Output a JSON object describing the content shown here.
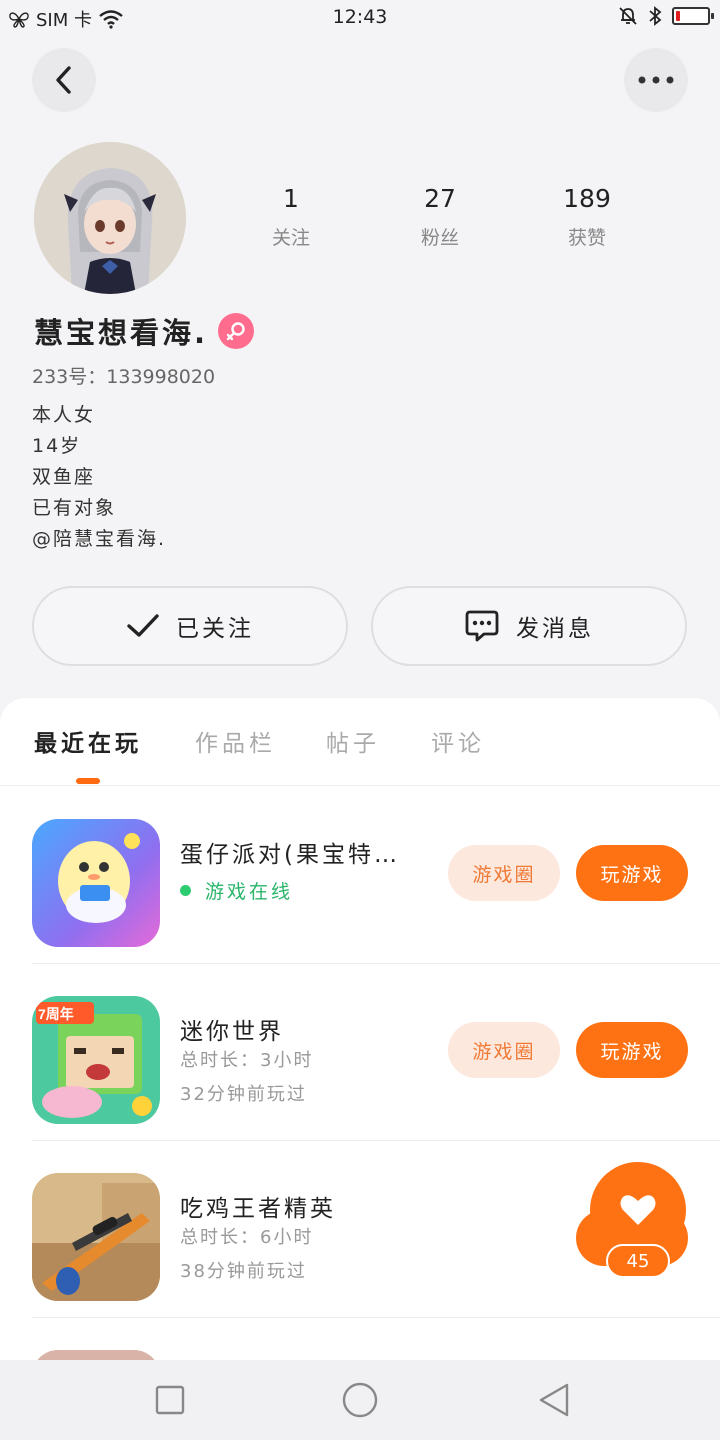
{
  "status_bar": {
    "carrier": "SIM 卡",
    "time": "12:43",
    "battery_level": 0.12
  },
  "nav": {
    "back_icon": "chevron-left-icon",
    "more_icon": "more-dots-icon"
  },
  "profile": {
    "nickname": "慧宝想看海.",
    "gender": "female",
    "uid": "233号：133998020",
    "bio": [
      "本人女",
      "14岁",
      "双鱼座",
      "已有对象",
      "@陪慧宝看海."
    ],
    "stats": [
      {
        "value": "1",
        "label": "关注"
      },
      {
        "value": "27",
        "label": "粉丝"
      },
      {
        "value": "189",
        "label": "获赞"
      }
    ]
  },
  "actions": {
    "follow_label": "已关注",
    "message_label": "发消息"
  },
  "tabs": [
    "最近在玩",
    "作品栏",
    "帖子",
    "评论"
  ],
  "active_tab": 0,
  "games": [
    {
      "title": "蛋仔派对(果宝特…",
      "status": "游戏在线",
      "circle_label": "游戏圈",
      "play_label": "玩游戏"
    },
    {
      "title": "迷你世界",
      "duration": "总时长：3小时",
      "last_played": "32分钟前玩过",
      "circle_label": "游戏圈",
      "play_label": "玩游戏"
    },
    {
      "title": "吃鸡王者精英",
      "duration": "总时长：6小时",
      "last_played": "38分钟前玩过"
    }
  ],
  "like_fab": {
    "count": "45",
    "icon": "heart-icon"
  },
  "colors": {
    "accent": "#ff7213",
    "online": "#2ab56b",
    "gender_badge": "#ff6c8d"
  },
  "system_nav": [
    "square-icon",
    "circle-icon",
    "triangle-back-icon"
  ]
}
